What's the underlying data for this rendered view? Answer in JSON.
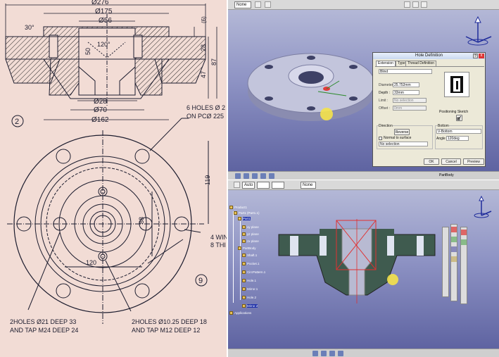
{
  "drawing": {
    "section_dims": {
      "d_276": "Ø276",
      "d_175": "Ø175",
      "d_56": "Ø56",
      "angle_30": "30°",
      "angle_120": "120°",
      "h_6": "(6)",
      "h_50": "50",
      "h_28": "28",
      "h_87": "87",
      "h_47": "47",
      "d_28": "Ø28",
      "d_70": "Ø70",
      "d_162": "Ø162"
    },
    "view_number": "2",
    "holes_note_line1": "6 HOLES Ø 2",
    "holes_note_line2": "ON PCØ 225",
    "dim_119": "119",
    "dim_88": "88",
    "dim_120": "120",
    "right_note_line1": "4 WIN",
    "right_note_line2": "8 THI",
    "view_number_9": "9",
    "note_left_line1": "2HOLES Ø21 DEEP 33",
    "note_left_line2": "AND  TAP M24 DEEP 24",
    "note_right_line1": "2HOLES Ø10.25 DEEP 18",
    "note_right_line2": "AND TAP M12 DEEP 12"
  },
  "top_window": {
    "toolbar_select": "None",
    "hole_dialog": {
      "title": "Hole Definition",
      "help_label": "?",
      "close_label": "x",
      "tabs": [
        "Extension",
        "Type",
        "Thread Definition"
      ],
      "extension_type": "Blind",
      "diameter_label": "Diameter :",
      "diameter_value": "25.752mm",
      "depth_label": "Depth :",
      "depth_value": "33mm",
      "limit_label": "Limit :",
      "limit_value": "No selection",
      "offset_label": "Offset :",
      "offset_value": "0mm",
      "positioning_sketch_label": "Positioning Sketch",
      "direction_label": "Direction",
      "reverse_label": "Reverse",
      "normal_label": "Normal to surface",
      "direction_value": "No selection",
      "bottom_label": "Bottom",
      "bottom_value": "V-Bottom",
      "angle_label": "Angle :",
      "angle_value": "120deg",
      "ok_label": "OK",
      "cancel_label": "Cancel",
      "preview_label": "Preview"
    },
    "status_text": "PartBody"
  },
  "bottom_window": {
    "toolbar_selects": [
      "Auto",
      "",
      "",
      "None"
    ],
    "spec_tree": [
      "Product1",
      "Part1 (Part1.1)",
      "Part1",
      "xy plane",
      "yz plane",
      "zx plane",
      "PartBody",
      "Shaft.1",
      "Pocket.1",
      "CircPattern.1",
      "Hole.1",
      "Mirror.1",
      "Hole.2",
      "Mirror.2",
      "Applications"
    ]
  },
  "colors": {
    "paper": "#f2dcd5",
    "viewport_top": "#b9bdd9",
    "viewport_bottom": "#5a5f9e",
    "part_gray": "#b8bad2",
    "part_green": "#3f5b4f",
    "section_red": "#e03030"
  }
}
